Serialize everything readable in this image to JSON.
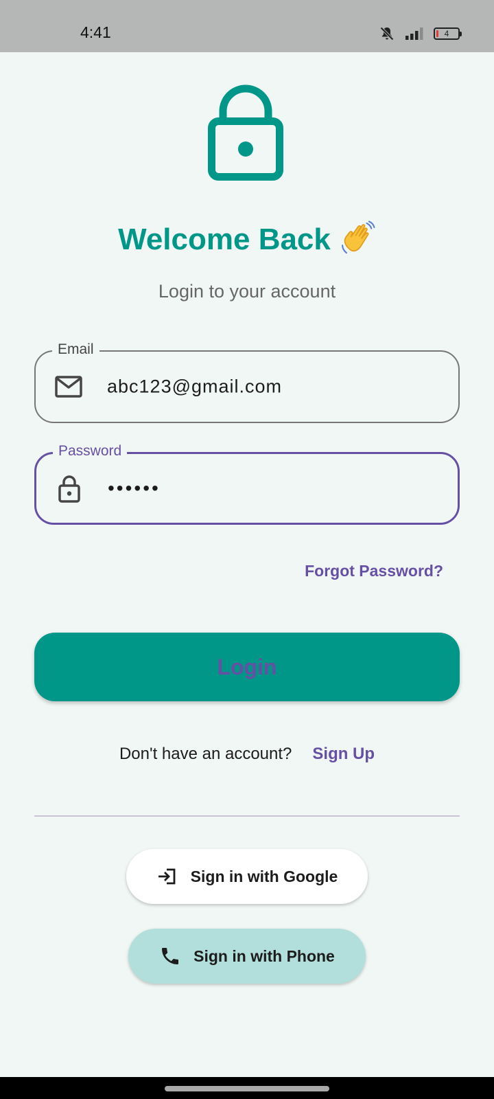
{
  "status_bar": {
    "time": "4:41",
    "battery_level": "4",
    "icons": [
      "bell-off-icon",
      "signal-icon",
      "battery-icon"
    ]
  },
  "header": {
    "hero_icon": "lock-icon",
    "title": "Welcome Back",
    "title_emoji": "waving-hand-icon",
    "subtitle": "Login to your account"
  },
  "form": {
    "email": {
      "label": "Email",
      "value": "abc123@gmail.com",
      "icon": "mail-icon"
    },
    "password": {
      "label": "Password",
      "value": "••••••",
      "icon": "lock-icon"
    },
    "forgot_password": "Forgot Password?",
    "login_label": "Login"
  },
  "signup": {
    "prompt": "Don't have an account?",
    "link": "Sign Up"
  },
  "social": {
    "google_label": "Sign in with Google",
    "google_icon": "login-arrow-icon",
    "phone_label": "Sign in with Phone",
    "phone_icon": "phone-icon"
  },
  "colors": {
    "primary": "#009688",
    "accent": "#6750a4",
    "background": "#f1f7f5",
    "phone_button": "#b2dfdb",
    "status_bar": "#b4b7b6"
  }
}
